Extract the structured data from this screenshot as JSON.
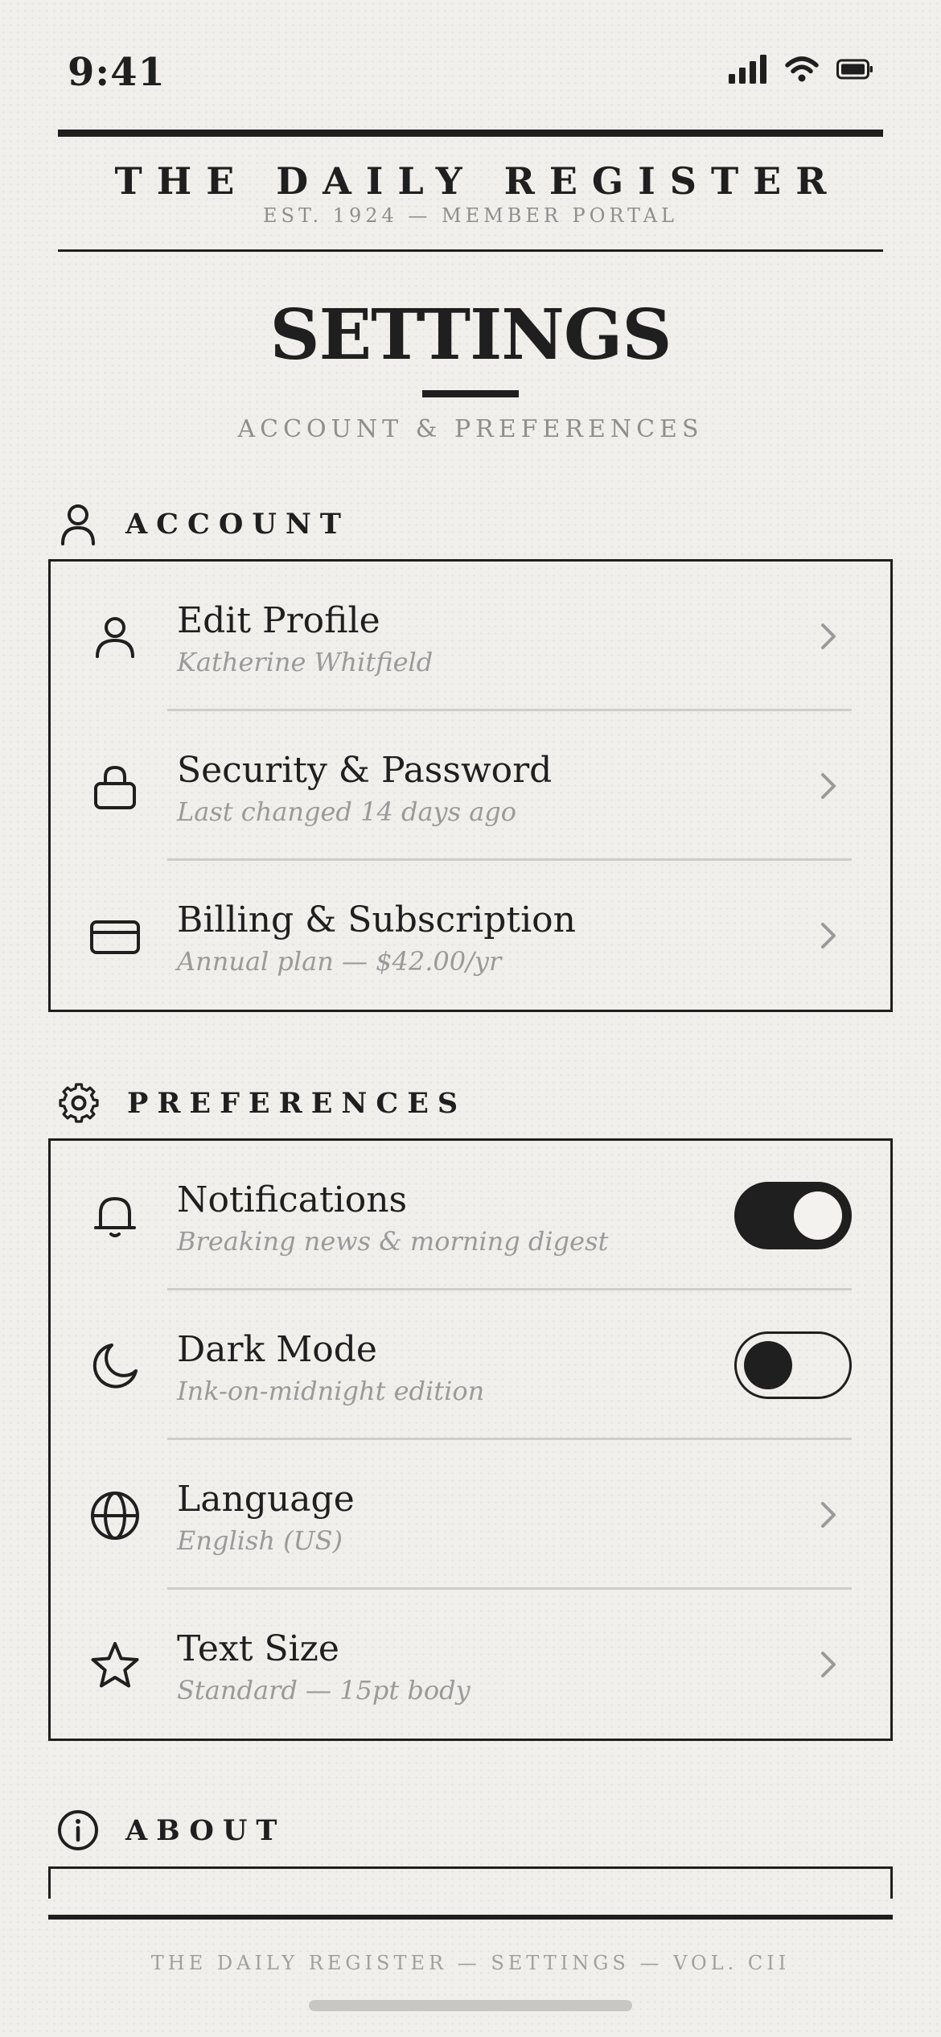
{
  "status_bar": {
    "time": "9:41",
    "icons": [
      "cellular-signal-icon",
      "wifi-icon",
      "battery-icon"
    ]
  },
  "masthead": {
    "title": "THE DAILY REGISTER",
    "tagline": "EST. 1924 — MEMBER PORTAL"
  },
  "page": {
    "title": "SETTINGS",
    "subtitle": "ACCOUNT & PREFERENCES"
  },
  "sections": {
    "account": {
      "label": "ACCOUNT",
      "icon": "person-icon",
      "rows": [
        {
          "title": "Edit Profile",
          "subtitle": "Katherine Whitfield",
          "icon": "person-icon",
          "control": "chevron"
        },
        {
          "title": "Security & Password",
          "subtitle": "Last changed 14 days ago",
          "icon": "lock-icon",
          "control": "chevron"
        },
        {
          "title": "Billing & Subscription",
          "subtitle": "Annual plan — $42.00/yr",
          "icon": "credit-card-icon",
          "control": "chevron"
        }
      ]
    },
    "preferences": {
      "label": "PREFERENCES",
      "icon": "gear-icon",
      "rows": [
        {
          "title": "Notifications",
          "subtitle": "Breaking news & morning digest",
          "icon": "bell-icon",
          "control": "toggle",
          "enabled": true
        },
        {
          "title": "Dark Mode",
          "subtitle": "Ink-on-midnight edition",
          "icon": "moon-icon",
          "control": "toggle",
          "enabled": false
        },
        {
          "title": "Language",
          "subtitle": "English (US)",
          "icon": "globe-icon",
          "control": "chevron"
        },
        {
          "title": "Text Size",
          "subtitle": "Standard — 15pt body",
          "icon": "star-icon",
          "control": "chevron"
        }
      ]
    },
    "about": {
      "label": "ABOUT",
      "icon": "info-icon"
    }
  },
  "footer": {
    "text": "THE DAILY REGISTER — SETTINGS — VOL. CII"
  },
  "colors": {
    "ink": "#1f1f1f",
    "paper": "#f1efeb",
    "muted": "#9a9a9a",
    "divider": "#cfcdc9"
  }
}
